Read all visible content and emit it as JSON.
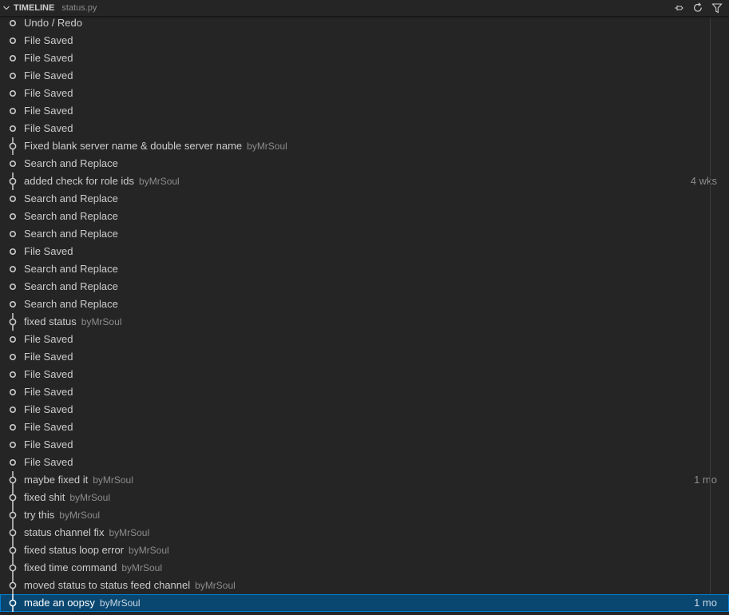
{
  "header": {
    "title": "TIMELINE",
    "subtitle": "status.py",
    "icons": [
      "chevron-down-icon",
      "pin-icon",
      "refresh-icon",
      "filter-icon"
    ]
  },
  "items": [
    {
      "label": "Undo / Redo",
      "author": "",
      "time": "",
      "type": "local"
    },
    {
      "label": "File Saved",
      "author": "",
      "time": "",
      "type": "local"
    },
    {
      "label": "File Saved",
      "author": "",
      "time": "",
      "type": "local"
    },
    {
      "label": "File Saved",
      "author": "",
      "time": "",
      "type": "local"
    },
    {
      "label": "File Saved",
      "author": "",
      "time": "",
      "type": "local"
    },
    {
      "label": "File Saved",
      "author": "",
      "time": "",
      "type": "local"
    },
    {
      "label": "File Saved",
      "author": "",
      "time": "",
      "type": "local"
    },
    {
      "label": "Fixed blank server name & double server name",
      "author": "byMrSoul",
      "time": "",
      "type": "commit"
    },
    {
      "label": "Search and Replace",
      "author": "",
      "time": "",
      "type": "local"
    },
    {
      "label": "added check for role ids",
      "author": "byMrSoul",
      "time": "4 wks",
      "type": "commit"
    },
    {
      "label": "Search and Replace",
      "author": "",
      "time": "",
      "type": "local"
    },
    {
      "label": "Search and Replace",
      "author": "",
      "time": "",
      "type": "local"
    },
    {
      "label": "Search and Replace",
      "author": "",
      "time": "",
      "type": "local"
    },
    {
      "label": "File Saved",
      "author": "",
      "time": "",
      "type": "local"
    },
    {
      "label": "Search and Replace",
      "author": "",
      "time": "",
      "type": "local"
    },
    {
      "label": "Search and Replace",
      "author": "",
      "time": "",
      "type": "local"
    },
    {
      "label": "Search and Replace",
      "author": "",
      "time": "",
      "type": "local"
    },
    {
      "label": "fixed status",
      "author": "byMrSoul",
      "time": "",
      "type": "commit"
    },
    {
      "label": "File Saved",
      "author": "",
      "time": "",
      "type": "local"
    },
    {
      "label": "File Saved",
      "author": "",
      "time": "",
      "type": "local"
    },
    {
      "label": "File Saved",
      "author": "",
      "time": "",
      "type": "local"
    },
    {
      "label": "File Saved",
      "author": "",
      "time": "",
      "type": "local"
    },
    {
      "label": "File Saved",
      "author": "",
      "time": "",
      "type": "local"
    },
    {
      "label": "File Saved",
      "author": "",
      "time": "",
      "type": "local"
    },
    {
      "label": "File Saved",
      "author": "",
      "time": "",
      "type": "local"
    },
    {
      "label": "File Saved",
      "author": "",
      "time": "",
      "type": "local"
    },
    {
      "label": "maybe fixed it",
      "author": "byMrSoul",
      "time": "1 mo",
      "type": "commit"
    },
    {
      "label": "fixed shit",
      "author": "byMrSoul",
      "time": "",
      "type": "commit"
    },
    {
      "label": "try this",
      "author": "byMrSoul",
      "time": "",
      "type": "commit"
    },
    {
      "label": "status channel fix",
      "author": "byMrSoul",
      "time": "",
      "type": "commit"
    },
    {
      "label": "fixed status loop error",
      "author": "byMrSoul",
      "time": "",
      "type": "commit"
    },
    {
      "label": "fixed time command",
      "author": "byMrSoul",
      "time": "",
      "type": "commit"
    },
    {
      "label": "moved status to status feed channel",
      "author": "byMrSoul",
      "time": "",
      "type": "commit"
    },
    {
      "label": "made an oopsy",
      "author": "byMrSoul",
      "time": "1 mo",
      "type": "commit",
      "selected": true
    }
  ],
  "colors": {
    "background": "#252526",
    "text": "#cccccc",
    "muted": "#8c8c8c",
    "selection": "#094771",
    "selection_border": "#007fd4"
  }
}
